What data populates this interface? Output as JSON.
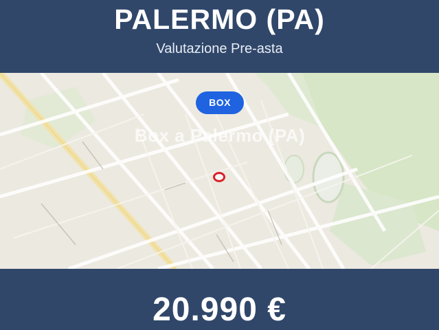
{
  "header": {
    "title": "PALERMO (PA)",
    "subtitle": "Valutazione Pre-asta"
  },
  "map": {
    "badge_label": "BOX",
    "caption": "Box a Palermo (PA)",
    "marker": "location-marker"
  },
  "footer": {
    "price": "20.990 €"
  },
  "colors": {
    "banner": "#30476a",
    "badge": "#1f63e0",
    "marker": "#d8202a",
    "map_background": "#ece9e0",
    "park": "#d6e6c6"
  }
}
